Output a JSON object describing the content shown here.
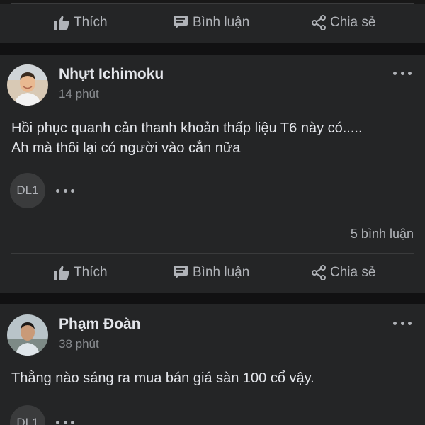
{
  "top_actions": {
    "like": "Thích",
    "comment": "Bình luận",
    "share": "Chia sẻ"
  },
  "posts": [
    {
      "author": "Nhựt Ichimoku",
      "time": "14 phút",
      "text_line1": "Hồi phục quanh cản thanh khoản thấp liệu T6 này có.....",
      "text_line2": "Ah mà thôi lại có người vào cắn nữa",
      "reactor": "DL1",
      "comment_count": "5 bình luận",
      "actions": {
        "like": "Thích",
        "comment": "Bình luận",
        "share": "Chia sẻ"
      }
    },
    {
      "author": "Phạm Đoàn",
      "time": "38 phút",
      "text_line1": "Thằng nào sáng ra mua bán giá sàn 100 cổ vậy.",
      "reactor": "DL1"
    }
  ],
  "colors": {
    "card_bg": "#242526",
    "page_bg": "#111112",
    "muted_text": "#b0b3b8",
    "primary_text": "#e4e6eb"
  },
  "icons": [
    "thumbs-up-icon",
    "comment-bubble-icon",
    "share-icon",
    "more-options-icon"
  ]
}
